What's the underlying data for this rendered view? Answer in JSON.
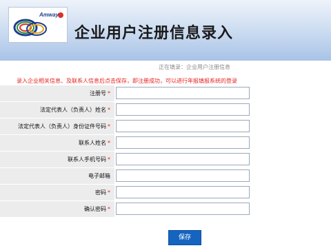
{
  "header": {
    "logo_text": "Amway",
    "title": "企业用户注册信息录入"
  },
  "status": {
    "text": "正在填录：企业用户注册信息"
  },
  "instruction": "录入企业相关信息、及联系人信息后点击保存，即注册成功，可以进行年报填报系统的登录",
  "form": {
    "required_mark": "*",
    "fields": [
      {
        "label": "注册号",
        "required": true,
        "value": ""
      },
      {
        "label": "法定代表人（负责人）姓名",
        "required": true,
        "value": ""
      },
      {
        "label": "法定代表人（负责人）身份证件号码",
        "required": true,
        "value": ""
      },
      {
        "label": "联系人姓名",
        "required": true,
        "value": ""
      },
      {
        "label": "联系人手机号码",
        "required": true,
        "value": ""
      },
      {
        "label": "电子邮箱",
        "required": false,
        "value": ""
      },
      {
        "label": "密码",
        "required": true,
        "value": ""
      },
      {
        "label": "确认密码",
        "required": true,
        "value": ""
      }
    ]
  },
  "actions": {
    "save_label": "保存"
  },
  "colors": {
    "accent": "#1565c0",
    "required": "#e52020",
    "row_bg": "#ececec"
  }
}
